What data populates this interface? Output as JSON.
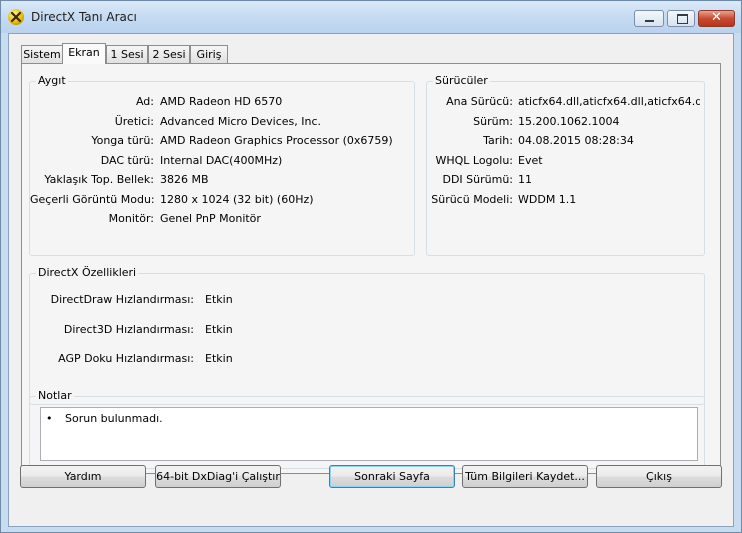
{
  "window": {
    "title": "DirectX Tanı Aracı"
  },
  "tabs": [
    "Sistem",
    "Ekran",
    "1 Sesi",
    "2 Sesi",
    "Giriş"
  ],
  "device": {
    "title": "Aygıt",
    "rows": [
      {
        "label": "Ad:",
        "value": "AMD Radeon HD 6570"
      },
      {
        "label": "Üretici:",
        "value": "Advanced Micro Devices, Inc."
      },
      {
        "label": "Yonga türü:",
        "value": "AMD Radeon Graphics Processor (0x6759)"
      },
      {
        "label": "DAC türü:",
        "value": "Internal DAC(400MHz)"
      },
      {
        "label": "Yaklaşık Top. Bellek:",
        "value": "3826 MB"
      },
      {
        "label": "Geçerli Görüntü Modu:",
        "value": "1280 x 1024 (32 bit) (60Hz)"
      },
      {
        "label": "Monitör:",
        "value": "Genel PnP Monitör"
      }
    ]
  },
  "drivers": {
    "title": "Sürücüler",
    "rows": [
      {
        "label": "Ana Sürücü:",
        "value": "aticfx64.dll,aticfx64.dll,aticfx64.dll,a"
      },
      {
        "label": "Sürüm:",
        "value": "15.200.1062.1004"
      },
      {
        "label": "Tarih:",
        "value": "04.08.2015 08:28:34"
      },
      {
        "label": "WHQL Logolu:",
        "value": "Evet"
      },
      {
        "label": "DDI Sürümü:",
        "value": "11"
      },
      {
        "label": "Sürücü Modeli:",
        "value": "WDDM 1.1"
      }
    ]
  },
  "features": {
    "title": "DirectX Özellikleri",
    "rows": [
      {
        "label": "DirectDraw Hızlandırması:",
        "value": "Etkin"
      },
      {
        "label": "Direct3D Hızlandırması:",
        "value": "Etkin"
      },
      {
        "label": "AGP Doku Hızlandırması:",
        "value": "Etkin"
      }
    ]
  },
  "notes": {
    "title": "Notlar",
    "bullet": "•",
    "text": "Sorun bulunmadı."
  },
  "buttons": {
    "help": "Yardım",
    "run64": "64-bit DxDiag'i Çalıştır",
    "next": "Sonraki Sayfa",
    "save": "Tüm Bilgileri Kaydet...",
    "exit": "Çıkış"
  }
}
